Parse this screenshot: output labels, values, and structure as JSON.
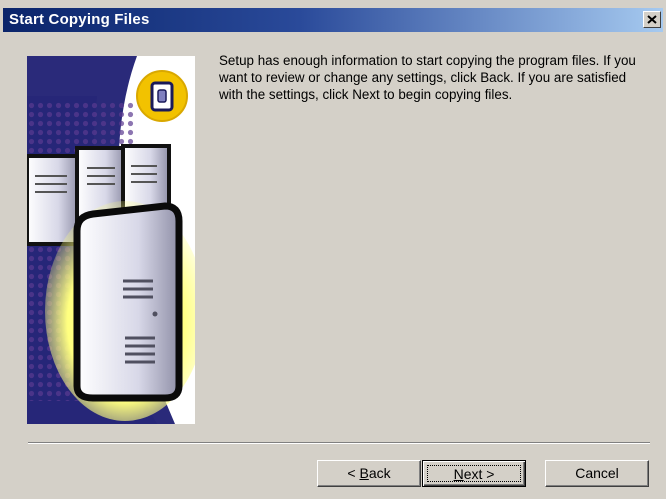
{
  "window": {
    "title": "Start Copying Files"
  },
  "main": {
    "description": "Setup has enough information to start copying the program files. If you want to review or change any settings, click Back.  If you are satisfied with the settings, click Next to begin copying files."
  },
  "buttons": {
    "back_mnemonic": "B",
    "back_rest": "ack",
    "back_prefix": "< ",
    "next_mnemonic": "N",
    "next_rest": "ext >",
    "cancel_label": "Cancel"
  },
  "icons": {
    "close": "close-icon",
    "badge": "database-icon",
    "artwork": "servers-illustration"
  },
  "colors": {
    "title_start": "#0a246a",
    "title_end": "#a6caf0",
    "face": "#d4d0c8",
    "art_blue": "#2a2a7a",
    "badge_yellow": "#f2c200"
  }
}
